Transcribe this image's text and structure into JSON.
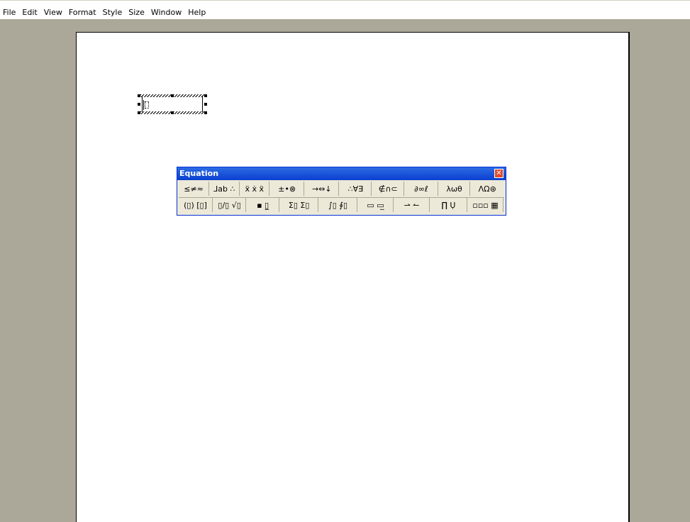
{
  "menu": {
    "items": [
      "File",
      "Edit",
      "View",
      "Format",
      "Style",
      "Size",
      "Window",
      "Help"
    ]
  },
  "equation_toolbar": {
    "title": "Equation",
    "close_icon": "close-icon",
    "row1": [
      {
        "name": "relational-symbols",
        "glyph": "≤≠≈"
      },
      {
        "name": "spaces-and-ellipses",
        "glyph": "⅃ab ∴"
      },
      {
        "name": "embellishments",
        "glyph": "ẍ ẋ ẍ"
      },
      {
        "name": "operator-symbols",
        "glyph": "±•⊗"
      },
      {
        "name": "arrow-symbols",
        "glyph": "→⇔↓"
      },
      {
        "name": "logical-symbols",
        "glyph": "∴∀∃"
      },
      {
        "name": "set-theory-symbols",
        "glyph": "∉∩⊂"
      },
      {
        "name": "miscellaneous-symbols",
        "glyph": "∂∞ℓ"
      },
      {
        "name": "greek-lowercase",
        "glyph": "λωθ"
      },
      {
        "name": "greek-uppercase",
        "glyph": "ΛΩ⊛"
      }
    ],
    "row2": [
      {
        "name": "fence-templates",
        "glyph": "(▯) [▯]"
      },
      {
        "name": "fraction-radical-templates",
        "glyph": "▯/▯ √▯"
      },
      {
        "name": "subscript-superscript-templates",
        "glyph": "▪ ▯̲"
      },
      {
        "name": "summation-templates",
        "glyph": "Σ▯ Σ▯"
      },
      {
        "name": "integral-templates",
        "glyph": "∫▯ ∮▯"
      },
      {
        "name": "underbar-overbar-templates",
        "glyph": "▭ ▭̲"
      },
      {
        "name": "labeled-arrow-templates",
        "glyph": "⇀ ↼"
      },
      {
        "name": "products-set-theory-templates",
        "glyph": "∏̇ Ụ"
      },
      {
        "name": "matrix-templates",
        "glyph": "▫▫▫ ▦"
      }
    ]
  }
}
